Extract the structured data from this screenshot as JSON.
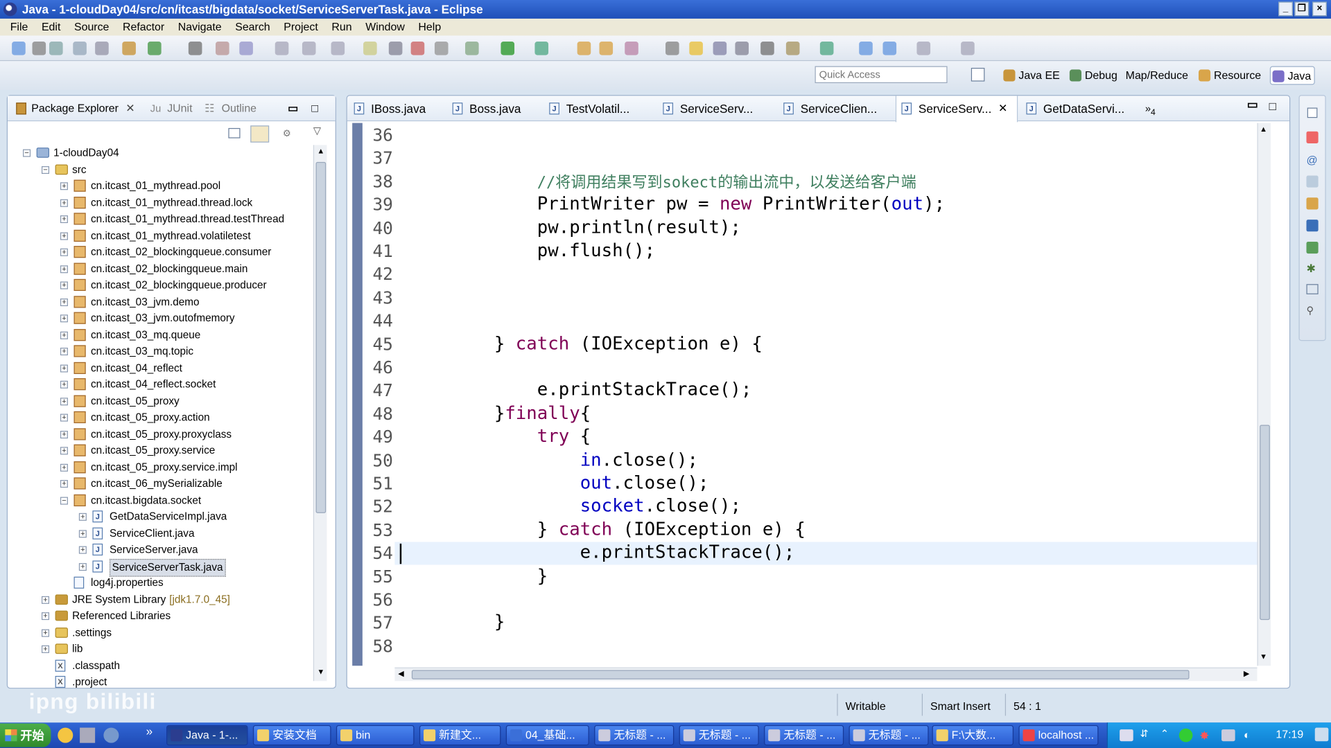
{
  "window": {
    "title": "Java - 1-cloudDay04/src/cn/itcast/bigdata/socket/ServiceServerTask.java - Eclipse"
  },
  "menu": [
    "File",
    "Edit",
    "Source",
    "Refactor",
    "Navigate",
    "Search",
    "Project",
    "Run",
    "Window",
    "Help"
  ],
  "quick_access": {
    "placeholder": "Quick Access"
  },
  "perspectives": [
    "Java EE",
    "Debug",
    "Map/Reduce",
    "Resource",
    "Java"
  ],
  "left_panel": {
    "tabs": [
      "Package Explorer",
      "JUnit",
      "Outline"
    ],
    "tree": [
      {
        "label": "1-cloudDay04",
        "depth": 0,
        "kind": "project"
      },
      {
        "label": "src",
        "depth": 1,
        "kind": "srcfolder"
      },
      {
        "label": "cn.itcast_01_mythread.pool",
        "depth": 2,
        "kind": "package"
      },
      {
        "label": "cn.itcast_01_mythread.thread.lock",
        "depth": 2,
        "kind": "package"
      },
      {
        "label": "cn.itcast_01_mythread.thread.testThread",
        "depth": 2,
        "kind": "package"
      },
      {
        "label": "cn.itcast_01_mythread.volatiletest",
        "depth": 2,
        "kind": "package"
      },
      {
        "label": "cn.itcast_02_blockingqueue.consumer",
        "depth": 2,
        "kind": "package"
      },
      {
        "label": "cn.itcast_02_blockingqueue.main",
        "depth": 2,
        "kind": "package"
      },
      {
        "label": "cn.itcast_02_blockingqueue.producer",
        "depth": 2,
        "kind": "package"
      },
      {
        "label": "cn.itcast_03_jvm.demo",
        "depth": 2,
        "kind": "package"
      },
      {
        "label": "cn.itcast_03_jvm.outofmemory",
        "depth": 2,
        "kind": "package"
      },
      {
        "label": "cn.itcast_03_mq.queue",
        "depth": 2,
        "kind": "package"
      },
      {
        "label": "cn.itcast_03_mq.topic",
        "depth": 2,
        "kind": "package"
      },
      {
        "label": "cn.itcast_04_reflect",
        "depth": 2,
        "kind": "package"
      },
      {
        "label": "cn.itcast_04_reflect.socket",
        "depth": 2,
        "kind": "package"
      },
      {
        "label": "cn.itcast_05_proxy",
        "depth": 2,
        "kind": "package"
      },
      {
        "label": "cn.itcast_05_proxy.action",
        "depth": 2,
        "kind": "package"
      },
      {
        "label": "cn.itcast_05_proxy.proxyclass",
        "depth": 2,
        "kind": "package"
      },
      {
        "label": "cn.itcast_05_proxy.service",
        "depth": 2,
        "kind": "package"
      },
      {
        "label": "cn.itcast_05_proxy.service.impl",
        "depth": 2,
        "kind": "package"
      },
      {
        "label": "cn.itcast_06_mySerializable",
        "depth": 2,
        "kind": "package"
      },
      {
        "label": "cn.itcast.bigdata.socket",
        "depth": 2,
        "kind": "package"
      },
      {
        "label": "GetDataServiceImpl.java",
        "depth": 3,
        "kind": "java"
      },
      {
        "label": "ServiceClient.java",
        "depth": 3,
        "kind": "java"
      },
      {
        "label": "ServiceServer.java",
        "depth": 3,
        "kind": "java"
      },
      {
        "label": "ServiceServerTask.java",
        "depth": 3,
        "kind": "java",
        "selected": true
      },
      {
        "label": "log4j.properties",
        "depth": 2,
        "kind": "file"
      },
      {
        "label": "JRE System Library",
        "suffix": "[jdk1.7.0_45]",
        "depth": 1,
        "kind": "library"
      },
      {
        "label": "Referenced Libraries",
        "depth": 1,
        "kind": "library"
      },
      {
        "label": ".settings",
        "depth": 1,
        "kind": "folder"
      },
      {
        "label": "lib",
        "depth": 1,
        "kind": "folder"
      },
      {
        "label": ".classpath",
        "depth": 1,
        "kind": "xfile"
      },
      {
        "label": ".project",
        "depth": 1,
        "kind": "xfile"
      }
    ]
  },
  "editor": {
    "tabs": [
      "IBoss.java",
      "Boss.java",
      "TestVolatil...",
      "ServiceServ...",
      "ServiceClien...",
      "ServiceServ...",
      "GetDataServi..."
    ],
    "active_tab_index": 5,
    "overflow_tabs": "4",
    "lines": [
      {
        "n": "36",
        "segs": []
      },
      {
        "n": "37",
        "segs": []
      },
      {
        "n": "38",
        "segs": [
          {
            "t": "            ",
            "c": ""
          },
          {
            "t": "//将调用结果写到sokect的输出流中，以发送给客户端",
            "c": "cmt"
          }
        ]
      },
      {
        "n": "39",
        "segs": [
          {
            "t": "            PrintWriter pw = ",
            "c": ""
          },
          {
            "t": "new",
            "c": "kw"
          },
          {
            "t": " PrintWriter(",
            "c": ""
          },
          {
            "t": "out",
            "c": "fld"
          },
          {
            "t": ");",
            "c": ""
          }
        ]
      },
      {
        "n": "40",
        "segs": [
          {
            "t": "            pw.println(result);",
            "c": ""
          }
        ]
      },
      {
        "n": "41",
        "segs": [
          {
            "t": "            pw.flush();",
            "c": ""
          }
        ]
      },
      {
        "n": "42",
        "segs": []
      },
      {
        "n": "43",
        "segs": []
      },
      {
        "n": "44",
        "segs": []
      },
      {
        "n": "45",
        "segs": [
          {
            "t": "        } ",
            "c": ""
          },
          {
            "t": "catch",
            "c": "kw"
          },
          {
            "t": " (IOException e) {",
            "c": ""
          }
        ]
      },
      {
        "n": "46",
        "segs": []
      },
      {
        "n": "47",
        "segs": [
          {
            "t": "            e.printStackTrace();",
            "c": ""
          }
        ]
      },
      {
        "n": "48",
        "segs": [
          {
            "t": "        }",
            "c": ""
          },
          {
            "t": "finally",
            "c": "kw"
          },
          {
            "t": "{",
            "c": ""
          }
        ]
      },
      {
        "n": "49",
        "segs": [
          {
            "t": "            ",
            "c": ""
          },
          {
            "t": "try",
            "c": "kw"
          },
          {
            "t": " {",
            "c": ""
          }
        ]
      },
      {
        "n": "50",
        "segs": [
          {
            "t": "                ",
            "c": ""
          },
          {
            "t": "in",
            "c": "fld"
          },
          {
            "t": ".close();",
            "c": ""
          }
        ]
      },
      {
        "n": "51",
        "segs": [
          {
            "t": "                ",
            "c": ""
          },
          {
            "t": "out",
            "c": "fld"
          },
          {
            "t": ".close();",
            "c": ""
          }
        ]
      },
      {
        "n": "52",
        "segs": [
          {
            "t": "                ",
            "c": ""
          },
          {
            "t": "socket",
            "c": "fld"
          },
          {
            "t": ".close();",
            "c": ""
          }
        ]
      },
      {
        "n": "53",
        "segs": [
          {
            "t": "            } ",
            "c": ""
          },
          {
            "t": "catch",
            "c": "kw"
          },
          {
            "t": " (IOException e) {",
            "c": ""
          }
        ]
      },
      {
        "n": "54",
        "segs": [
          {
            "t": "                e.printStackTrace();",
            "c": ""
          }
        ]
      },
      {
        "n": "55",
        "segs": [
          {
            "t": "            }",
            "c": ""
          }
        ]
      },
      {
        "n": "56",
        "segs": []
      },
      {
        "n": "57",
        "segs": [
          {
            "t": "        }",
            "c": ""
          }
        ]
      },
      {
        "n": "58",
        "segs": []
      }
    ]
  },
  "status": {
    "writable": "Writable",
    "insert_mode": "Smart Insert",
    "position": "54 : 1"
  },
  "taskbar": {
    "start": "开始",
    "tasks": [
      "Java - 1-...",
      "安装文档",
      "bin",
      "新建文...",
      "04_基础...",
      "无标题 - ...",
      "无标题 - ...",
      "无标题 - ...",
      "无标题 - ...",
      "F:\\大数...",
      "localhost ..."
    ],
    "clock": "17:19"
  },
  "watermark": "ipng bilibili",
  "colors": {
    "keyword": "#7f0055",
    "field": "#0000c0",
    "comment": "#3f7f5f",
    "titlebar": "#2a5dc8"
  }
}
